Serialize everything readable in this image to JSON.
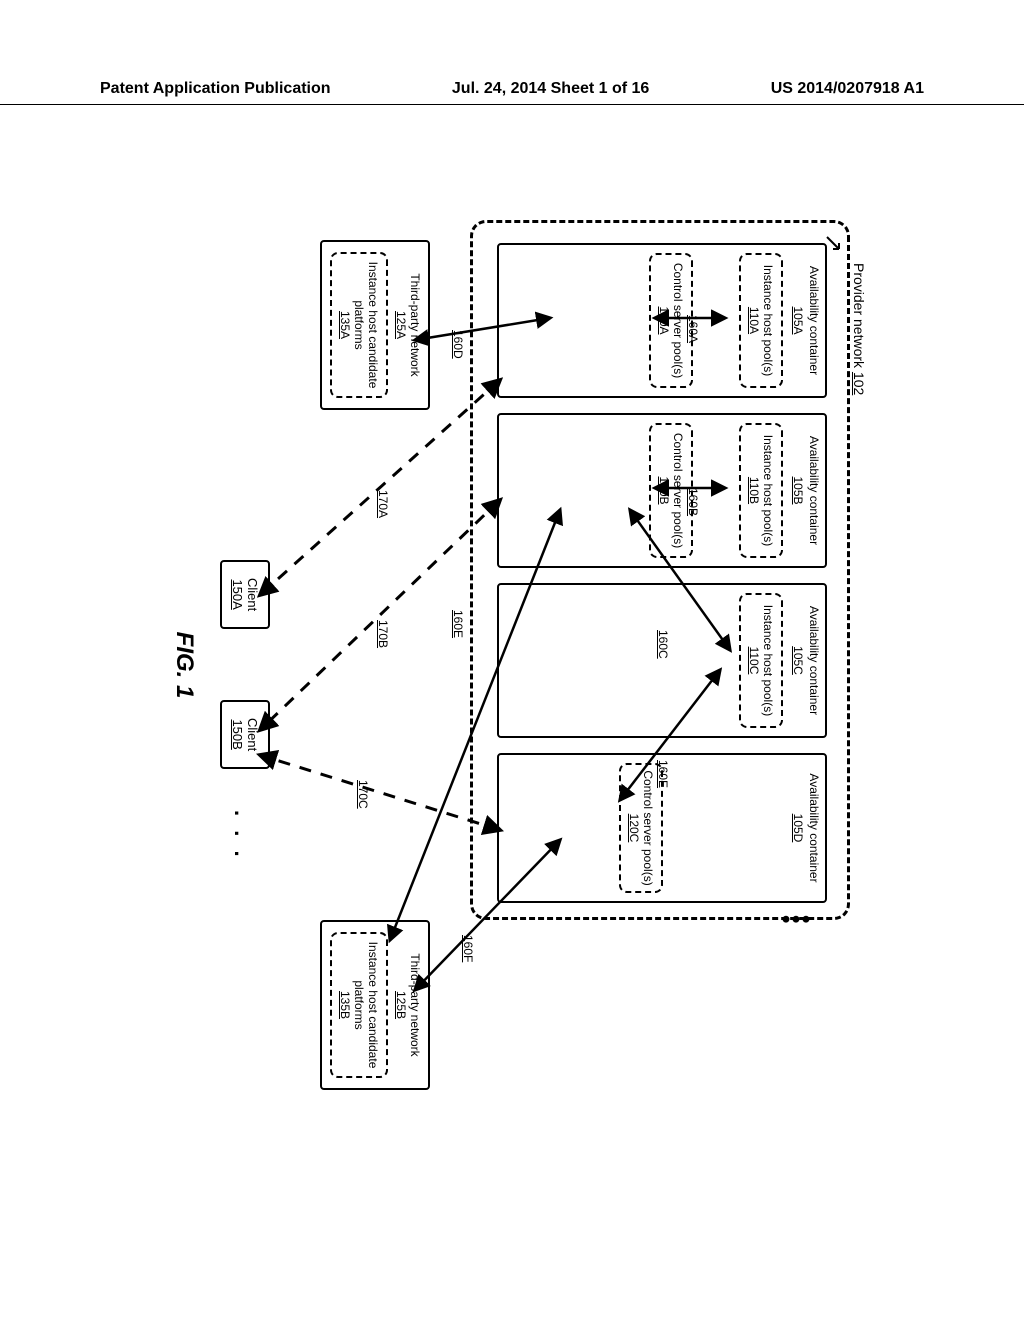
{
  "header": {
    "left": "Patent Application Publication",
    "center": "Jul. 24, 2014  Sheet 1 of 16",
    "right": "US 2014/0207918 A1"
  },
  "figure": {
    "label": "FIG. 1",
    "provider_label_prefix": "Provider network ",
    "provider_ref": "102",
    "avail_title": "Availability container",
    "avail": [
      {
        "ref": "105A",
        "ih_ref": "110A",
        "cs_ref": "120A",
        "ih_label": "Instance host pool(s) ",
        "cs_label": "Control server pool(s) "
      },
      {
        "ref": "105B",
        "ih_ref": "110B",
        "cs_ref": "120B",
        "ih_label": "Instance host pool(s) ",
        "cs_label": "Control server pool(s) "
      },
      {
        "ref": "105C",
        "ih_ref": "110C",
        "cs_ref": "",
        "ih_label": "Instance host pool(s) ",
        "cs_label": ""
      },
      {
        "ref": "105D",
        "ih_ref": "",
        "cs_ref": "120C",
        "ih_label": "",
        "cs_label": "Control server pool(s) "
      }
    ],
    "third_party": {
      "title": "Third-party network",
      "candidate_label": "Instance host candidate platforms",
      "A": {
        "ref": "125A",
        "cand_ref": "135A"
      },
      "B": {
        "ref": "125B",
        "cand_ref": "135B"
      }
    },
    "clients": {
      "label": "Client",
      "A_ref": "150A",
      "B_ref": "150B"
    },
    "edge_labels": {
      "e160A": "160A",
      "e160B": "160B",
      "e160C": "160C",
      "e160D": "160D",
      "e160E_left": "160E",
      "e160E_right": "160E",
      "e160F": "160F",
      "e170A": "170A",
      "e170B": "170B",
      "e170C": "170C"
    }
  }
}
